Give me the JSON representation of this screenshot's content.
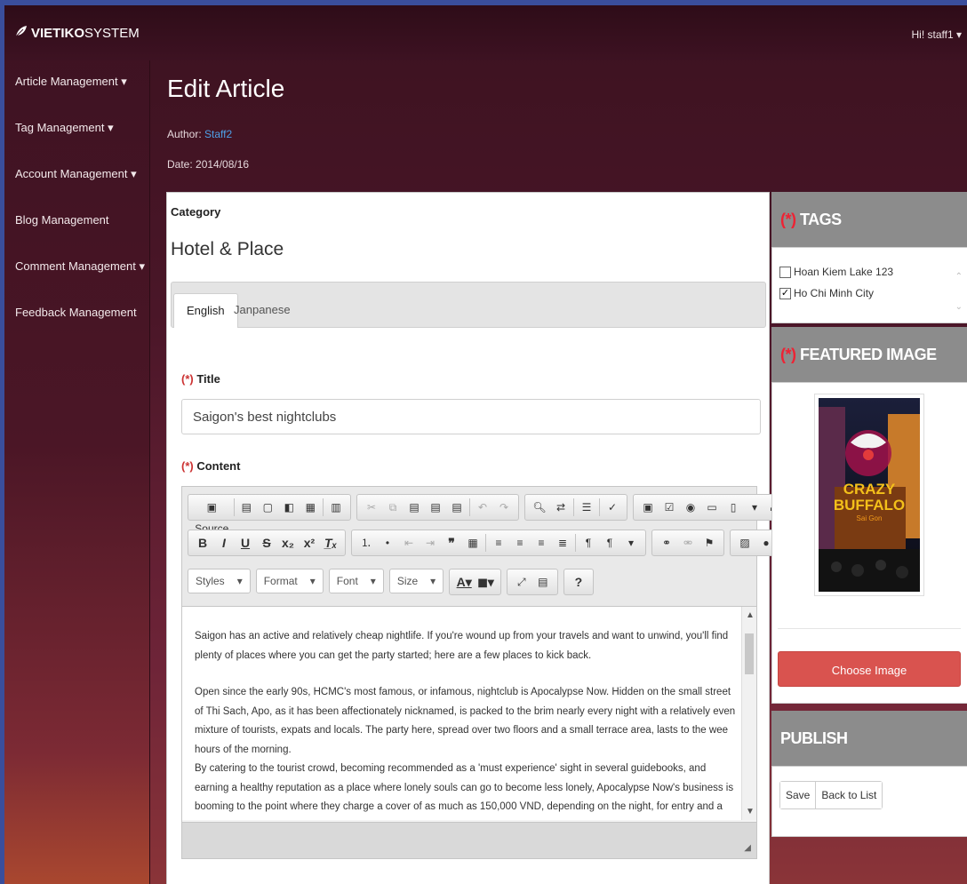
{
  "brand": {
    "bold": "VIETIKO",
    "rest": "SYSTEM"
  },
  "user": {
    "greeting": "Hi! staff1 ▾"
  },
  "nav": {
    "items": [
      {
        "label": "Article Management ▾"
      },
      {
        "label": "Tag Management ▾"
      },
      {
        "label": "Account Management ▾"
      },
      {
        "label": "Blog Management"
      },
      {
        "label": "Comment Management ▾"
      },
      {
        "label": "Feedback Management"
      }
    ]
  },
  "page": {
    "title": "Edit Article",
    "author_label": "Author:",
    "author_name": "Staff2",
    "date_text": "Date: 2014/08/16"
  },
  "category": {
    "label": "Category",
    "value": "Hotel & Place"
  },
  "tabs": [
    {
      "label": "English"
    },
    {
      "label": "Janpanese"
    }
  ],
  "form": {
    "title_label": "Title",
    "title_value": "Saigon's best nightclubs",
    "content_label": "Content",
    "required_marker": "(*)"
  },
  "editor": {
    "source_label": "Source",
    "combos": {
      "styles": "Styles",
      "format": "Format",
      "font": "Font",
      "size": "Size"
    },
    "paragraphs": [
      "Saigon has an active and relatively cheap nightlife. If you're wound up from your travels and want to unwind, you'll find plenty of places where you can get the party started; here are a few places to kick back.",
      "Open since the early 90s, HCMC's most famous, or infamous, nightclub is Apocalypse Now. Hidden on the small street of Thi Sach, Apo, as it has been affectionately nicknamed, is packed to the brim nearly every night with a relatively even mixture of tourists, expats and locals. The party here, spread over two floors and a small terrace area, lasts to the wee hours of the morning.",
      "By catering to the tourist crowd, becoming recommended as a 'must experience' sight in several guidebooks, and earning a healthy reputation as a place where lonely souls can go to become less lonely, Apocalypse Now's business is booming to the point where they charge a cover of as much as 150,000 VND, depending on the night, for entry and a drink."
    ]
  },
  "tags": {
    "heading": "TAGS",
    "required_marker": "(*)",
    "items": [
      {
        "label": "Hoan Kiem Lake 123",
        "checked": false
      },
      {
        "label": "Ho Chi Minh City",
        "checked": true
      }
    ]
  },
  "featured": {
    "heading": "FEATURED IMAGE",
    "required_marker": "(*)",
    "image_text_1": "CRAZY",
    "image_text_2": "BUFFALO",
    "image_text_3": "Sai Gon",
    "choose_label": "Choose Image"
  },
  "publish": {
    "heading": "PUBLISH",
    "save_label": "Save",
    "back_label": "Back to List"
  }
}
